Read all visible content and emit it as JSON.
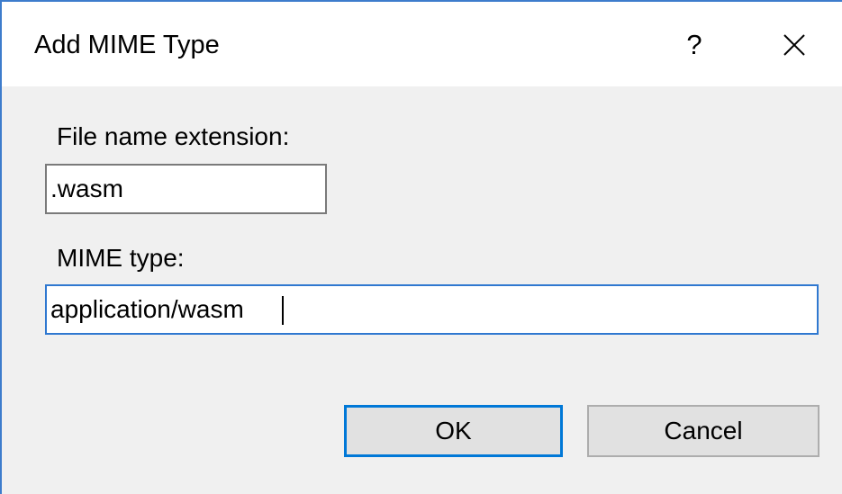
{
  "dialog": {
    "title": "Add MIME Type",
    "help_glyph": "?",
    "close_icon": "close-icon"
  },
  "form": {
    "extension_label": "File name extension:",
    "extension_value": ".wasm",
    "mime_label": "MIME type:",
    "mime_value": "application/wasm"
  },
  "buttons": {
    "ok_label": "OK",
    "cancel_label": "Cancel"
  },
  "colors": {
    "accent": "#0078d7",
    "window_border": "#3d7ccc",
    "dialog_bg": "#f0f0f0"
  }
}
